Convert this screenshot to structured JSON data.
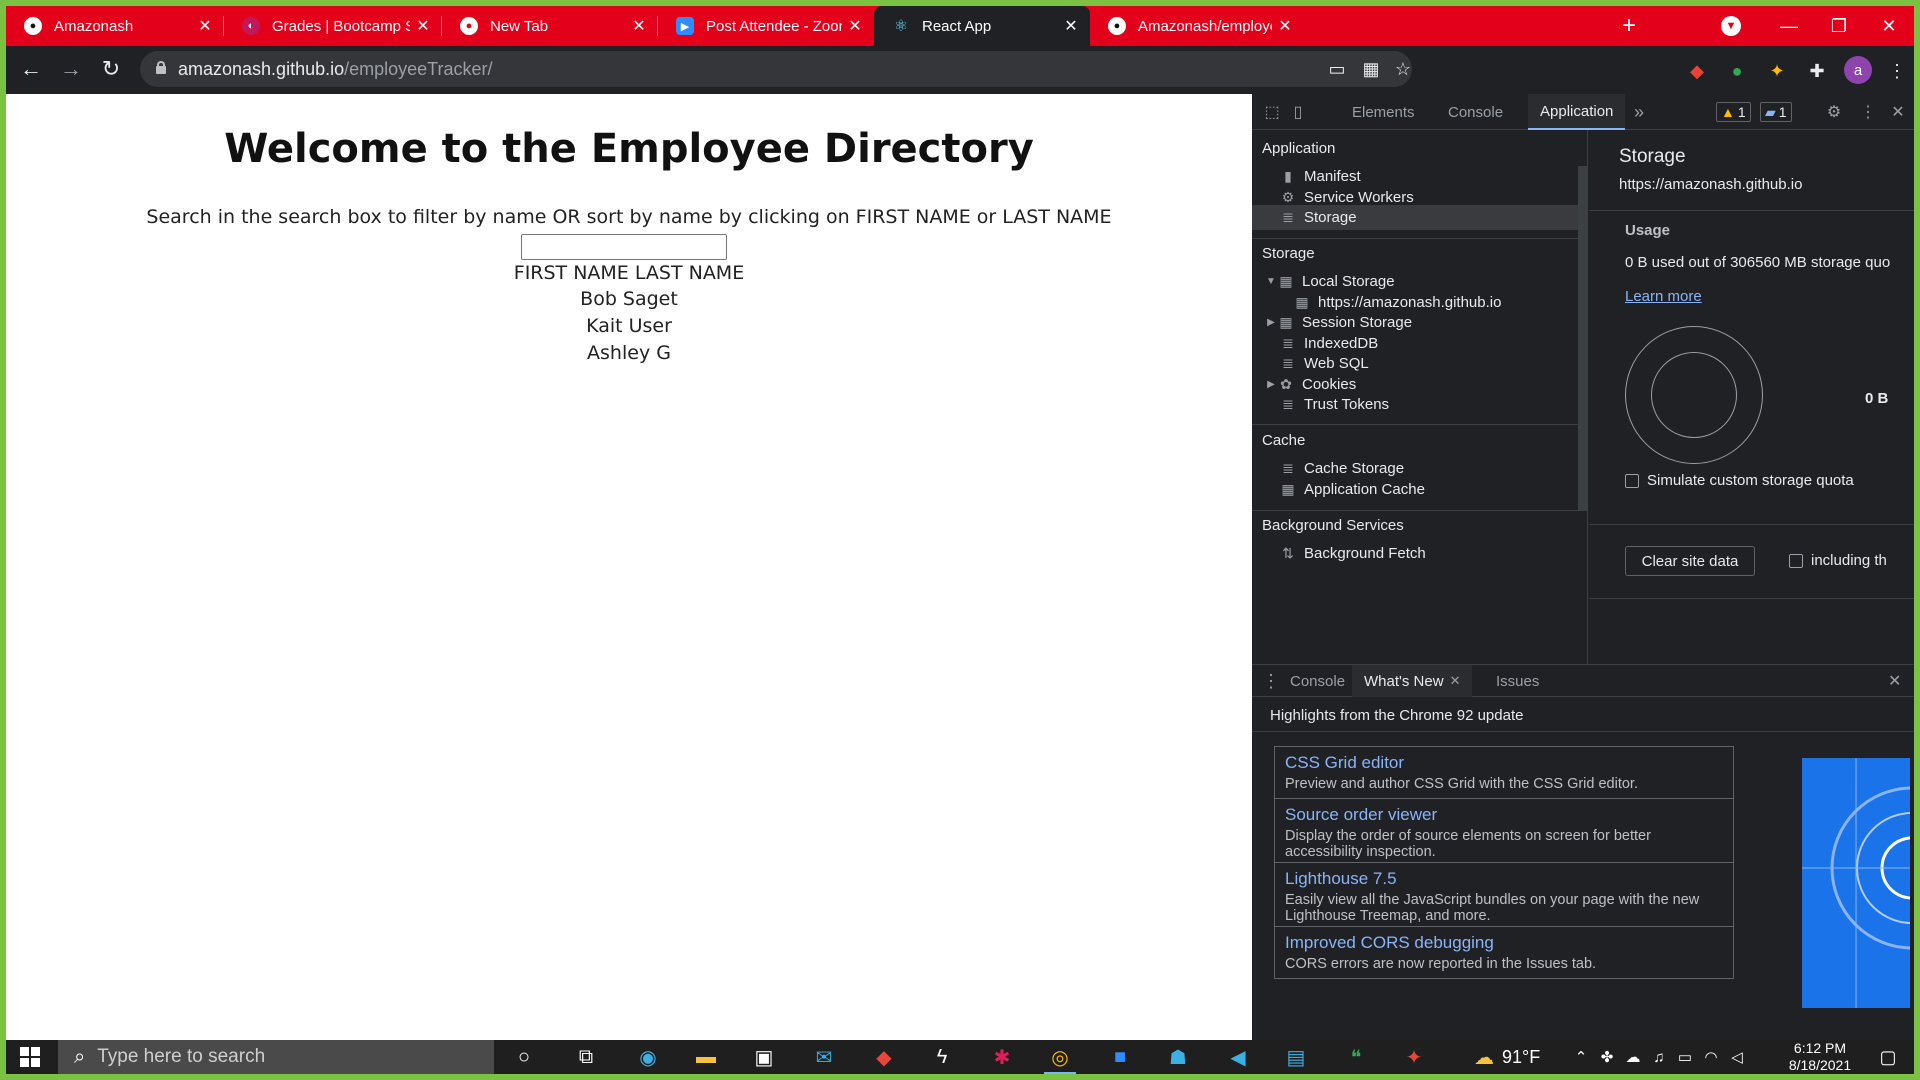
{
  "browser": {
    "tabs": [
      {
        "title": "Amazonash",
        "favicon": "github-icon"
      },
      {
        "title": "Grades | Bootcamp Spot",
        "favicon": "bootcamp-icon"
      },
      {
        "title": "New Tab",
        "favicon": "chrome-icon"
      },
      {
        "title": "Post Attendee - Zoom",
        "favicon": "zoom-icon"
      },
      {
        "title": "React App",
        "favicon": "react-icon"
      },
      {
        "title": "Amazonash/employeeTrack",
        "favicon": "github-icon"
      }
    ],
    "new_tab": "+",
    "url_host": "amazonash.github.io",
    "url_path": "/employeeTracker/",
    "profile_initial": "a"
  },
  "page": {
    "title": "Welcome to the Employee Directory",
    "instructions": "Search in the search box to filter by name OR sort by name by clicking on FIRST NAME or LAST NAME",
    "search_value": "",
    "col_first": "FIRST NAME",
    "col_last": "LAST NAME",
    "employees": [
      "Bob Saget",
      "Kait User",
      "Ashley G"
    ]
  },
  "devtools": {
    "tabs": [
      "Elements",
      "Console",
      "Application"
    ],
    "more": "»",
    "warn_count": "1",
    "msg_count": "1",
    "sidebar": {
      "application_header": "Application",
      "application_items": [
        "Manifest",
        "Service Workers",
        "Storage"
      ],
      "storage_header": "Storage",
      "storage_items": [
        "Local Storage",
        "https://amazonash.github.io",
        "Session Storage",
        "IndexedDB",
        "Web SQL",
        "Cookies",
        "Trust Tokens"
      ],
      "cache_header": "Cache",
      "cache_items": [
        "Cache Storage",
        "Application Cache"
      ],
      "bg_header": "Background Services",
      "bg_items": [
        "Background Fetch"
      ]
    },
    "storage": {
      "title": "Storage",
      "origin": "https://amazonash.github.io",
      "usage_header": "Usage",
      "usage_text": "0 B used out of 306560 MB storage quo",
      "learn_more": "Learn more",
      "legend_total": "0 B",
      "simulate_label": "Simulate custom storage quota",
      "clear_button": "Clear site data",
      "including_label": "including th"
    },
    "drawer": {
      "tabs": [
        "Console",
        "What's New",
        "Issues"
      ],
      "highlights": "Highlights from the Chrome 92 update",
      "cards": [
        {
          "title": "CSS Grid editor",
          "desc": "Preview and author CSS Grid with the CSS Grid editor."
        },
        {
          "title": "Source order viewer",
          "desc": "Display the order of source elements on screen for better accessibility inspection."
        },
        {
          "title": "Lighthouse 7.5",
          "desc": "Easily view all the JavaScript bundles on your page with the new Lighthouse Treemap, and more."
        },
        {
          "title": "Improved CORS debugging",
          "desc": "CORS errors are now reported in the Issues tab."
        }
      ]
    }
  },
  "taskbar": {
    "search_placeholder": "Type here to search",
    "temperature": "91°F",
    "time": "6:12 PM",
    "date": "8/18/2021"
  },
  "colors": {
    "tab_strip": "#e3001b",
    "desktop_border": "#7cc242",
    "devtools_bg": "#202124",
    "accent_link": "#8ab4f8"
  }
}
